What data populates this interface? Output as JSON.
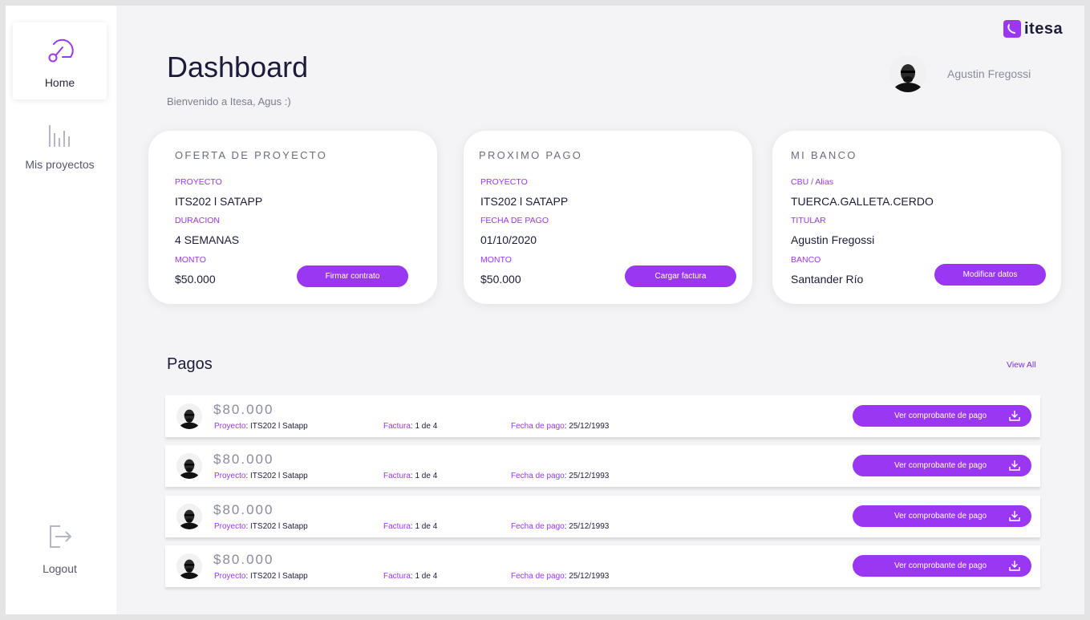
{
  "sidebar": {
    "items": [
      {
        "label": "Home",
        "icon": "speedometer-icon"
      },
      {
        "label": "Mis proyectos",
        "icon": "bar-chart-icon"
      }
    ],
    "logout": {
      "label": "Logout",
      "icon": "logout-icon"
    }
  },
  "brand": {
    "name": "itesa",
    "accent": "#9a37f2"
  },
  "header": {
    "title": "Dashboard",
    "subtitle": "Bienvenido a Itesa, Agus :)",
    "user_name": "Agustin Fregossi"
  },
  "cards": [
    {
      "title": "OFERTA DE PROYECTO",
      "fields": [
        {
          "label": "PROYECTO",
          "value": "ITS202 l SATAPP"
        },
        {
          "label": "DURACION",
          "value": "4 SEMANAS"
        },
        {
          "label": "MONTO",
          "value": "$50.000"
        }
      ],
      "button": "Firmar contrato"
    },
    {
      "title": "PROXIMO PAGO",
      "fields": [
        {
          "label": "PROYECTO",
          "value": "ITS202 l SATAPP"
        },
        {
          "label": "FECHA DE PAGO",
          "value": "01/10/2020"
        },
        {
          "label": "MONTO",
          "value": "$50.000"
        }
      ],
      "button": "Cargar factura"
    },
    {
      "title": "MI BANCO",
      "fields": [
        {
          "label": "CBU / Alias",
          "value": "TUERCA.GALLETA.CERDO"
        },
        {
          "label": "TITULAR",
          "value": "Agustin Fregossi"
        },
        {
          "label": "BANCO",
          "value": "Santander Río"
        }
      ],
      "button": "Modificar datos"
    }
  ],
  "payments": {
    "title": "Pagos",
    "view_all": "View All",
    "rows": [
      {
        "amount": "$80.000",
        "project_label": "Proyecto",
        "project": "ITS202 l Satapp",
        "invoice_label": "Factura",
        "invoice": "1 de 4",
        "date_label": "Fecha de pago",
        "date": "25/12/1993",
        "button": "Ver comprobante de pago"
      },
      {
        "amount": "$80.000",
        "project_label": "Proyecto",
        "project": "ITS202 l Satapp",
        "invoice_label": "Factura",
        "invoice": "1 de 4",
        "date_label": "Fecha de pago",
        "date": "25/12/1993",
        "button": "Ver comprobante de pago"
      },
      {
        "amount": "$80.000",
        "project_label": "Proyecto",
        "project": "ITS202 l Satapp",
        "invoice_label": "Factura",
        "invoice": "1 de 4",
        "date_label": "Fecha de pago",
        "date": "25/12/1993",
        "button": "Ver comprobante de pago"
      },
      {
        "amount": "$80.000",
        "project_label": "Proyecto",
        "project": "ITS202 l Satapp",
        "invoice_label": "Factura",
        "invoice": "1 de 4",
        "date_label": "Fecha de pago",
        "date": "25/12/1993",
        "button": "Ver comprobante de pago"
      }
    ]
  }
}
